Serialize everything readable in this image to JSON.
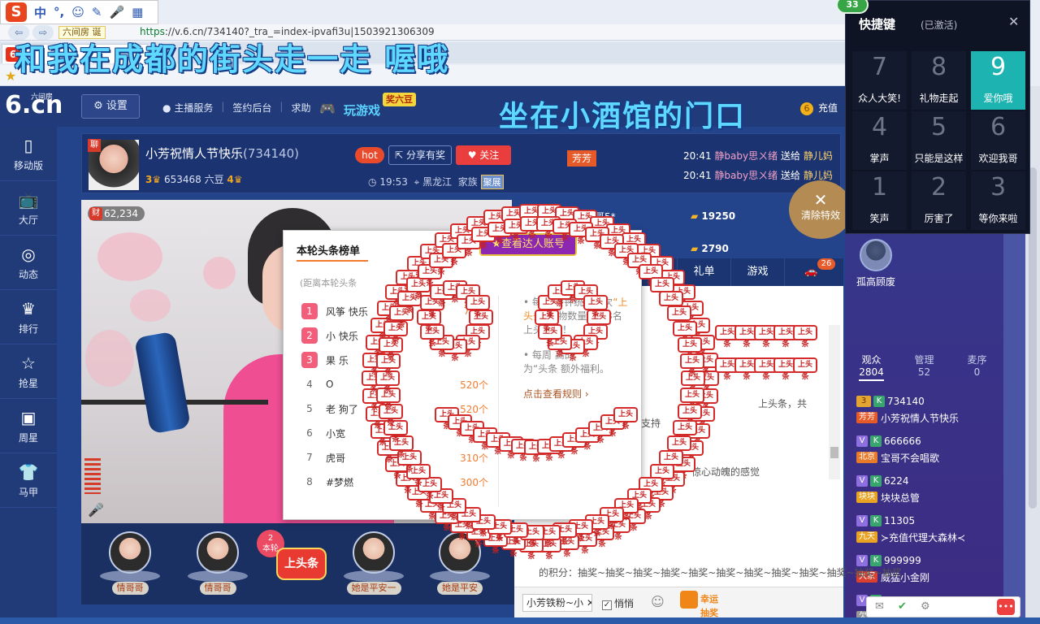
{
  "ime": {
    "logo": "S",
    "items": [
      "中",
      "°,",
      "☺",
      "✎",
      "🎤",
      "▦"
    ]
  },
  "browser": {
    "tab_label": "六间房 诞",
    "url_proto": "https",
    "url_rest": "://v.6.cn/734140?_tra_=index-ipvafi3u|1503921306309",
    "tab_icon": "6"
  },
  "overlay_title": "和我在成都的街头走一走  喔哦",
  "overlay_sub": "坐在小酒馆的门口",
  "site": {
    "logo_text": "6.cn",
    "logo_small": "六间房",
    "settings_label": "设置",
    "links": [
      "主播服务",
      "签约后台",
      "求助"
    ],
    "game_label": "玩游戏",
    "game_tag": "奖六豆",
    "recharge_label": "充值"
  },
  "nav": [
    {
      "icon": "mobile-icon",
      "glyph": "▯",
      "label": "移动版"
    },
    {
      "icon": "tv-icon",
      "glyph": "📺",
      "label": "大厅"
    },
    {
      "icon": "compass-icon",
      "glyph": "◎",
      "label": "动态"
    },
    {
      "icon": "crown-icon",
      "glyph": "♛",
      "label": "排行"
    },
    {
      "icon": "star-icon",
      "glyph": "☆",
      "label": "抢星"
    },
    {
      "icon": "gift-box-icon",
      "glyph": "▣",
      "label": "周星"
    },
    {
      "icon": "shirt-icon",
      "glyph": "👕",
      "label": "马甲"
    }
  ],
  "host": {
    "tag": "聊",
    "name": "小芳祝情人节快乐",
    "room_id": "(734140)",
    "level_left": "3",
    "beans": "653468 六豆",
    "level_right": "4",
    "hot": "hot",
    "share_label": "分享有奖",
    "follow_label": "关注",
    "time": "19:53",
    "location": "黑龙江",
    "family_label": "家族",
    "family_name": "聚展"
  },
  "fangfang_tag": "芳芳",
  "gift_news": [
    {
      "time": "20:41",
      "user": "静baby",
      "text": "思ㄨ绪",
      "verb": "送给",
      "to": "静儿妈"
    },
    {
      "time": "20:41",
      "user": "静baby",
      "text": "思ㄨ绪",
      "verb": "送给",
      "to": "静儿妈"
    }
  ],
  "video": {
    "wealth_tag": "财",
    "wealth_value": "62,234"
  },
  "headline": {
    "title": "本轮头条榜单",
    "note": "(距离本轮头条",
    "rows": [
      {
        "rank": "1",
        "name": "风筝",
        "suffix": "快乐",
        "value": "7777"
      },
      {
        "rank": "2",
        "name": "小",
        "suffix": "快乐",
        "value": ""
      },
      {
        "rank": "3",
        "name": "果",
        "suffix": "乐",
        "value": ""
      },
      {
        "rank": "4",
        "name": "O",
        "suffix": "",
        "value": "520个"
      },
      {
        "rank": "5",
        "name": "老",
        "suffix": "狗了",
        "value": "520个"
      },
      {
        "rank": "6",
        "name": "小宽",
        "suffix": "",
        "value": ""
      },
      {
        "rank": "7",
        "name": "虎哥",
        "suffix": "",
        "value": "310个"
      },
      {
        "rank": "8",
        "name": "#梦燃",
        "suffix": "",
        "value": "300个"
      }
    ],
    "rule_1a": "每30分钟统计一次",
    "rule_1b": "“上头条”",
    "rule_1c": "礼物数量，前3名上头条哦！",
    "rule_2a": "每周",
    "rule_2b": "高的",
    "rule_2c": "为“头条",
    "rule_2d": "额外福利。",
    "rule_link": "点击查看规则 ›"
  },
  "view_tag": "★查看达人账号",
  "rich_list": [
    {
      "name": "刚哥5*",
      "amount": "19250"
    },
    {
      "name": "一生的爱",
      "amount": "2790"
    }
  ],
  "clear_effects": {
    "x": "✕",
    "label": "清除特效"
  },
  "chat_tabs": [
    "礼单",
    "游戏"
  ],
  "chat_badge": "26",
  "chat_lines": [
    {
      "text": "上头条，共"
    },
    {
      "text": "支持"
    },
    {
      "text": "惊心动魄的感觉"
    }
  ],
  "raffle_text": "的积分：抽奖~抽奖~抽奖~抽奖~抽奖~抽奖~抽奖~抽奖~抽奖~抽奖~抽奖~抽奖",
  "gift_strip": [
    {
      "name": "情哥哥"
    },
    {
      "name": "情哥哥"
    },
    {
      "name": "她是平安一"
    },
    {
      "name": "她是平安"
    }
  ],
  "round_badge": {
    "num": "2",
    "label": "本轮",
    "main": "上头条"
  },
  "chat_input": {
    "target": "小芳铁粉~小",
    "private_label": "悄悄",
    "lotto_line1": "幸运",
    "lotto_line2": "抽奖"
  },
  "right": {
    "user_name": "孤高顾废",
    "tabs": [
      {
        "label": "观众",
        "count": "2804"
      },
      {
        "label": "管理",
        "count": "52"
      },
      {
        "label": "麦序",
        "count": "0"
      }
    ],
    "viewers": [
      {
        "lv": "3",
        "id": "734140",
        "tag": "芳芳",
        "tag_color": "#e65a2a",
        "name": "小芳祝情人节快乐"
      },
      {
        "lv": "V",
        "id": "666666",
        "tag": "北京",
        "tag_color": "#e87b2a",
        "name": "宝哥不会唱歌"
      },
      {
        "lv": "V",
        "id": "6224",
        "tag": "块块",
        "tag_color": "#e7a321",
        "name": "块块总管"
      },
      {
        "lv": "V",
        "id": "11305",
        "tag": "九天",
        "tag_color": "#e7a321",
        "name": "≻充值代理大森林≺"
      },
      {
        "lv": "V",
        "id": "999999",
        "tag": "大家",
        "tag_color": "#d94030",
        "name": "威猛小金刚"
      },
      {
        "lv": "V",
        "id": "",
        "tag": "欠",
        "tag_color": "#999999",
        "name": ""
      }
    ]
  },
  "shortcut": {
    "title": "快捷键",
    "status": "(已激活)",
    "badge": "33",
    "keys": [
      {
        "num": "7",
        "cap": "众人大笑!"
      },
      {
        "num": "8",
        "cap": "礼物走起"
      },
      {
        "num": "9",
        "cap": "爱你哦",
        "active": true
      },
      {
        "num": "4",
        "cap": "掌声"
      },
      {
        "num": "5",
        "cap": "只能是这样"
      },
      {
        "num": "6",
        "cap": "欢迎我哥"
      },
      {
        "num": "1",
        "cap": "笑声"
      },
      {
        "num": "2",
        "cap": "厉害了"
      },
      {
        "num": "3",
        "cap": "等你来啦"
      }
    ]
  },
  "effect_text": "上头条"
}
